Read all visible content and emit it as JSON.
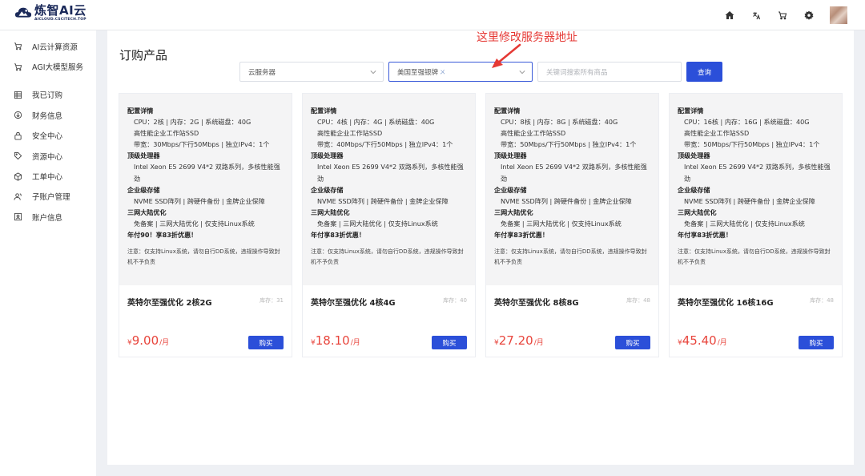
{
  "brand": {
    "title": "炼智AI云",
    "subtitle": "AICLOUD.CSCITECH.TOP"
  },
  "topbar": {
    "icons": [
      "home-icon",
      "translate-icon",
      "cart-icon",
      "settings-icon"
    ],
    "avatar": "avatar"
  },
  "sidebar": {
    "group1": [
      {
        "label": "AI云计算资源",
        "icon": "cart-icon"
      },
      {
        "label": "AGI大模型服务",
        "icon": "cart-icon"
      }
    ],
    "group2": [
      {
        "label": "我已订购",
        "icon": "list-icon"
      },
      {
        "label": "财务信息",
        "icon": "finance-icon"
      },
      {
        "label": "安全中心",
        "icon": "lock-icon"
      },
      {
        "label": "资源中心",
        "icon": "tag-icon"
      },
      {
        "label": "工单中心",
        "icon": "cube-icon"
      },
      {
        "label": "子账户管理",
        "icon": "users-icon"
      },
      {
        "label": "账户信息",
        "icon": "profile-icon"
      }
    ]
  },
  "page": {
    "title": "订购产品"
  },
  "filters": {
    "category": "云服务器",
    "region": "美国至强银牌",
    "region_tag": "ㄨ",
    "search_placeholder": "关键词搜索所有商品",
    "search_button": "查询"
  },
  "annotation": {
    "text": "这里修改服务器地址"
  },
  "products": [
    {
      "h1": "配置详情",
      "spec": "CPU：2核 | 内存：2G | 系统磁盘：40G",
      "ssd": "高性能企业工作站SSD",
      "bw": "带宽：30Mbps/下行50Mbps | 独立IPv4：1个",
      "h2": "顶级处理器",
      "cpu": "Intel Xeon E5 2699 V4*2 双路系列，多核性能强劲",
      "h3": "企业级存储",
      "storage": "NVME SSD阵列 | 跨硬件备份 | 金牌企业保障",
      "h4": "三网大陆优化",
      "net": "免备案 | 三网大陆优化 | 仅支持Linux系统",
      "promo": "年付90！享83折优惠！",
      "note": "注意：仅支持Linux系统，请勿自行DD系统，违规操作导致封机不予负责",
      "name": "英特尔至强优化 2核2G",
      "stock": "库存：31",
      "currency": "¥",
      "price": "9.00",
      "unit": "/月",
      "buy": "购买"
    },
    {
      "h1": "配置详情",
      "spec": "CPU：4核 | 内存：4G | 系统磁盘：40G",
      "ssd": "高性能企业工作站SSD",
      "bw": "带宽：40Mbps/下行50Mbps | 独立IPv4：1个",
      "h2": "顶级处理器",
      "cpu": "Intel Xeon E5 2699 V4*2 双路系列，多核性能强劲",
      "h3": "企业级存储",
      "storage": "NVME SSD阵列 | 跨硬件备份 | 金牌企业保障",
      "h4": "三网大陆优化",
      "net": "免备案 | 三网大陆优化 | 仅支持Linux系统",
      "promo": "年付享83折优惠！",
      "note": "注意：仅支持Linux系统，请勿自行DD系统，违规操作导致封机不予负责",
      "name": "英特尔至强优化 4核4G",
      "stock": "库存：40",
      "currency": "¥",
      "price": "18.10",
      "unit": "/月",
      "buy": "购买"
    },
    {
      "h1": "配置详情",
      "spec": "CPU：8核 | 内存：8G | 系统磁盘：40G",
      "ssd": "高性能企业工作站SSD",
      "bw": "带宽：50Mbps/下行50Mbps | 独立IPv4：1个",
      "h2": "顶级处理器",
      "cpu": "Intel Xeon E5 2699 V4*2 双路系列，多核性能强劲",
      "h3": "企业级存储",
      "storage": "NVME SSD阵列 | 跨硬件备份 | 金牌企业保障",
      "h4": "三网大陆优化",
      "net": "免备案 | 三网大陆优化 | 仅支持Linux系统",
      "promo": "年付享83折优惠！",
      "note": "注意：仅支持Linux系统，请勿自行DD系统，违规操作导致封机不予负责",
      "name": "英特尔至强优化 8核8G",
      "stock": "库存：48",
      "currency": "¥",
      "price": "27.20",
      "unit": "/月",
      "buy": "购买"
    },
    {
      "h1": "配置详情",
      "spec": "CPU：16核 | 内存：16G | 系统磁盘：40G",
      "ssd": "高性能企业工作站SSD",
      "bw": "带宽：50Mbps/下行50Mbps | 独立IPv4：1个",
      "h2": "顶级处理器",
      "cpu": "Intel Xeon E5 2699 V4*2 双路系列，多核性能强劲",
      "h3": "企业级存储",
      "storage": "NVME SSD阵列 | 跨硬件备份 | 金牌企业保障",
      "h4": "三网大陆优化",
      "net": "免备案 | 三网大陆优化 | 仅支持Linux系统",
      "promo": "年付享83折优惠！",
      "note": "注意：仅支持Linux系统，请勿自行DD系统，违规操作导致封机不予负责",
      "name": "英特尔至强优化 16核16G",
      "stock": "库存：48",
      "currency": "¥",
      "price": "45.40",
      "unit": "/月",
      "buy": "购买"
    }
  ]
}
